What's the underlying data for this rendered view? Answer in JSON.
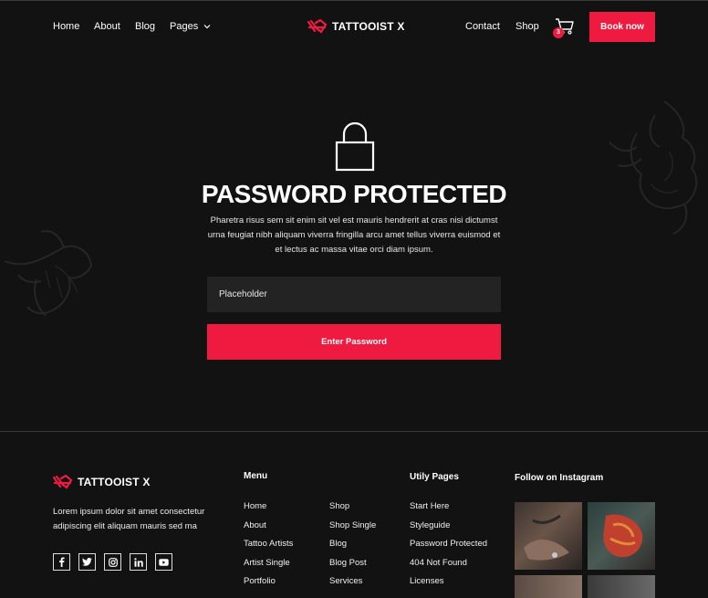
{
  "header": {
    "nav_left": [
      {
        "label": "Home"
      },
      {
        "label": "About"
      },
      {
        "label": "Blog"
      },
      {
        "label": "Pages"
      }
    ],
    "logo_text": "TATTOOIST X",
    "nav_right": [
      {
        "label": "Contact"
      },
      {
        "label": "Shop"
      }
    ],
    "cart_count": "3",
    "book_label": "Book now"
  },
  "hero": {
    "title": "PASSWORD PROTECTED",
    "description": "Pharetra risus sem sit enim sit vel est mauris hendrerit at cras nisi dictumst urna feugiat nibh aliquam viverra fringilla arcu amet tellus viverra euismod et et lectus ac massa vitae orci diam ipsum.",
    "input_placeholder": "Placeholder",
    "submit_label": "Enter Password"
  },
  "footer": {
    "logo_text": "TATTOOIST X",
    "about_text": "Lorem ipsum dolor sit amet consectetur adipiscing elit aliquam mauris sed ma",
    "socials": [
      "facebook-icon",
      "twitter-icon",
      "instagram-icon",
      "linkedin-icon",
      "youtube-icon"
    ],
    "menu_title": "Menu",
    "menu_col1": [
      "Home",
      "About",
      "Tattoo Artists",
      "Artist Single",
      "Portfolio"
    ],
    "menu_col2": [
      "Shop",
      "Shop Single",
      "Blog",
      "Blog Post",
      "Services"
    ],
    "utility_title": "Utily Pages",
    "utility_links": [
      "Start Here",
      "Styleguide",
      "Password Protected",
      "404 Not Found",
      "Licenses"
    ],
    "instagram_title": "Follow on Instagram"
  },
  "colors": {
    "accent": "#ef1a3f",
    "background": "#121213",
    "input_bg": "#232324"
  }
}
